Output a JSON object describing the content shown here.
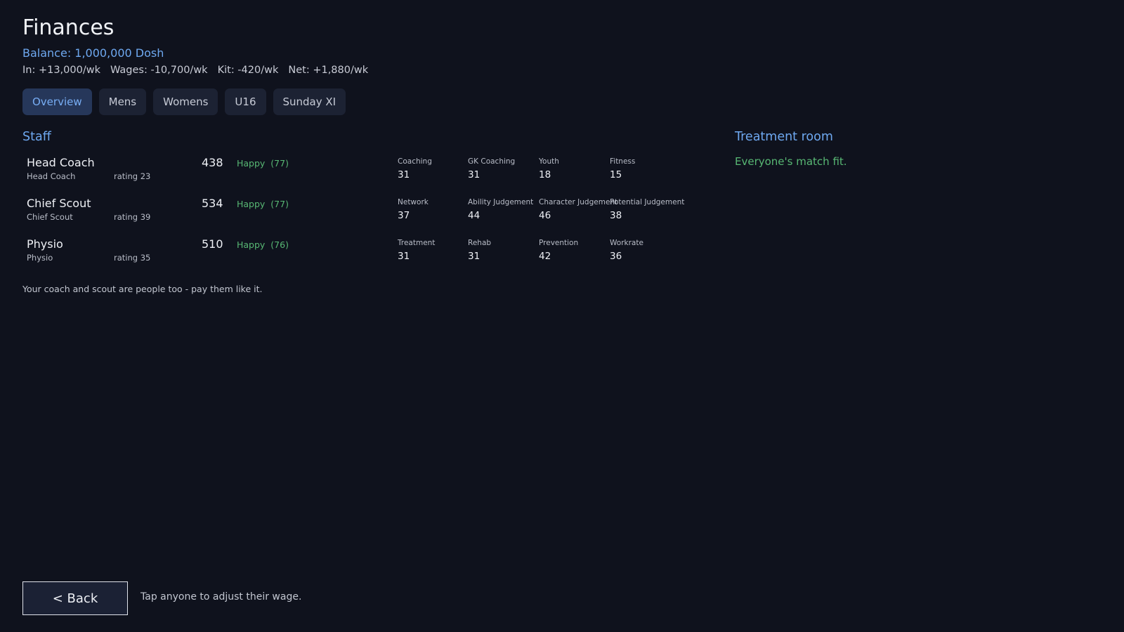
{
  "header": {
    "title": "Finances",
    "balance": "Balance: 1,000,000 Dosh",
    "summary": {
      "in": "In: +13,000/wk",
      "wages": "Wages: -10,700/wk",
      "kit": "Kit: -420/wk",
      "net": "Net: +1,880/wk"
    }
  },
  "tabs": [
    {
      "label": "Overview",
      "active": true
    },
    {
      "label": "Mens"
    },
    {
      "label": "Womens"
    },
    {
      "label": "U16"
    },
    {
      "label": "Sunday XI"
    }
  ],
  "staff": {
    "title": "Staff",
    "rows": [
      {
        "name": "Head Coach",
        "role": "Head Coach",
        "rating": "rating 23",
        "wage": "438",
        "mood": "Happy",
        "mood_score": "(77)",
        "stats": [
          {
            "label": "Coaching",
            "value": "31"
          },
          {
            "label": "GK Coaching",
            "value": "31"
          },
          {
            "label": "Youth",
            "value": "18"
          },
          {
            "label": "Fitness",
            "value": "15"
          }
        ]
      },
      {
        "name": "Chief Scout",
        "role": "Chief Scout",
        "rating": "rating 39",
        "wage": "534",
        "mood": "Happy",
        "mood_score": "(77)",
        "stats": [
          {
            "label": "Network",
            "value": "37"
          },
          {
            "label": "Ability Judgement",
            "value": "44"
          },
          {
            "label": "Character Judgement",
            "value": "46"
          },
          {
            "label": "Potential Judgement",
            "value": "38"
          }
        ]
      },
      {
        "name": "Physio",
        "role": "Physio",
        "rating": "rating 35",
        "wage": "510",
        "mood": "Happy",
        "mood_score": "(76)",
        "stats": [
          {
            "label": "Treatment",
            "value": "31"
          },
          {
            "label": "Rehab",
            "value": "31"
          },
          {
            "label": "Prevention",
            "value": "42"
          },
          {
            "label": "Workrate",
            "value": "36"
          }
        ]
      }
    ],
    "hint": "Your coach and scout are people too - pay them like it."
  },
  "treatment": {
    "title": "Treatment room",
    "message": "Everyone's match fit."
  },
  "footer": {
    "back_label": "< Back",
    "hint": "Tap anyone to adjust their wage."
  },
  "colors": {
    "background": "#0f121d",
    "accent": "#6ea8f0",
    "happy": "#58b874"
  }
}
